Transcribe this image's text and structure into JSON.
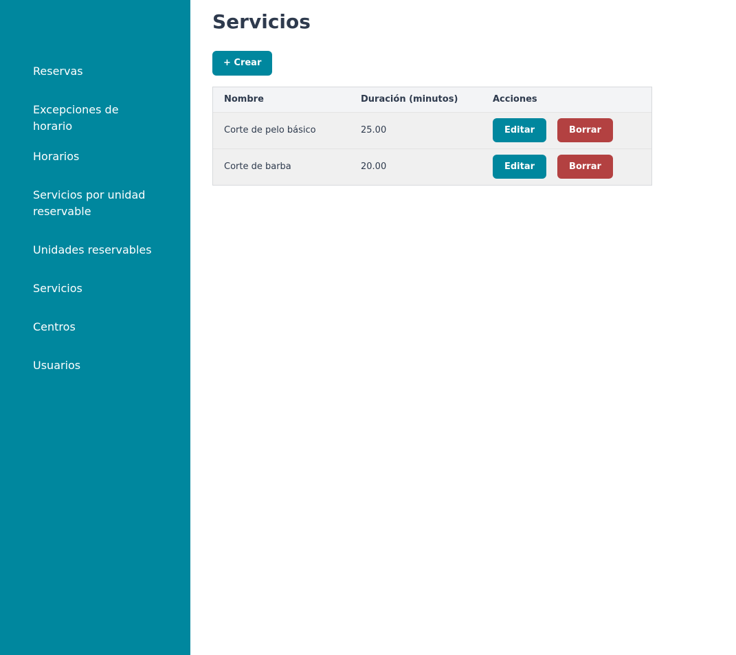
{
  "sidebar": {
    "items": [
      {
        "label": "Reservas"
      },
      {
        "label": "Excepciones de horario"
      },
      {
        "label": "Horarios"
      },
      {
        "label": "Servicios por unidad reservable"
      },
      {
        "label": "Unidades reservables"
      },
      {
        "label": "Servicios"
      },
      {
        "label": "Centros"
      },
      {
        "label": "Usuarios"
      }
    ]
  },
  "main": {
    "title": "Servicios",
    "create_label": "+ Crear",
    "table": {
      "headers": [
        "Nombre",
        "Duración (minutos)",
        "Acciones"
      ],
      "rows": [
        {
          "name": "Corte de pelo básico",
          "duration": "25.00"
        },
        {
          "name": "Corte de barba",
          "duration": "20.00"
        }
      ],
      "edit_label": "Editar",
      "delete_label": "Borrar"
    }
  },
  "colors": {
    "primary": "#00879e",
    "danger": "#b34141",
    "text": "#2e3a4d"
  }
}
